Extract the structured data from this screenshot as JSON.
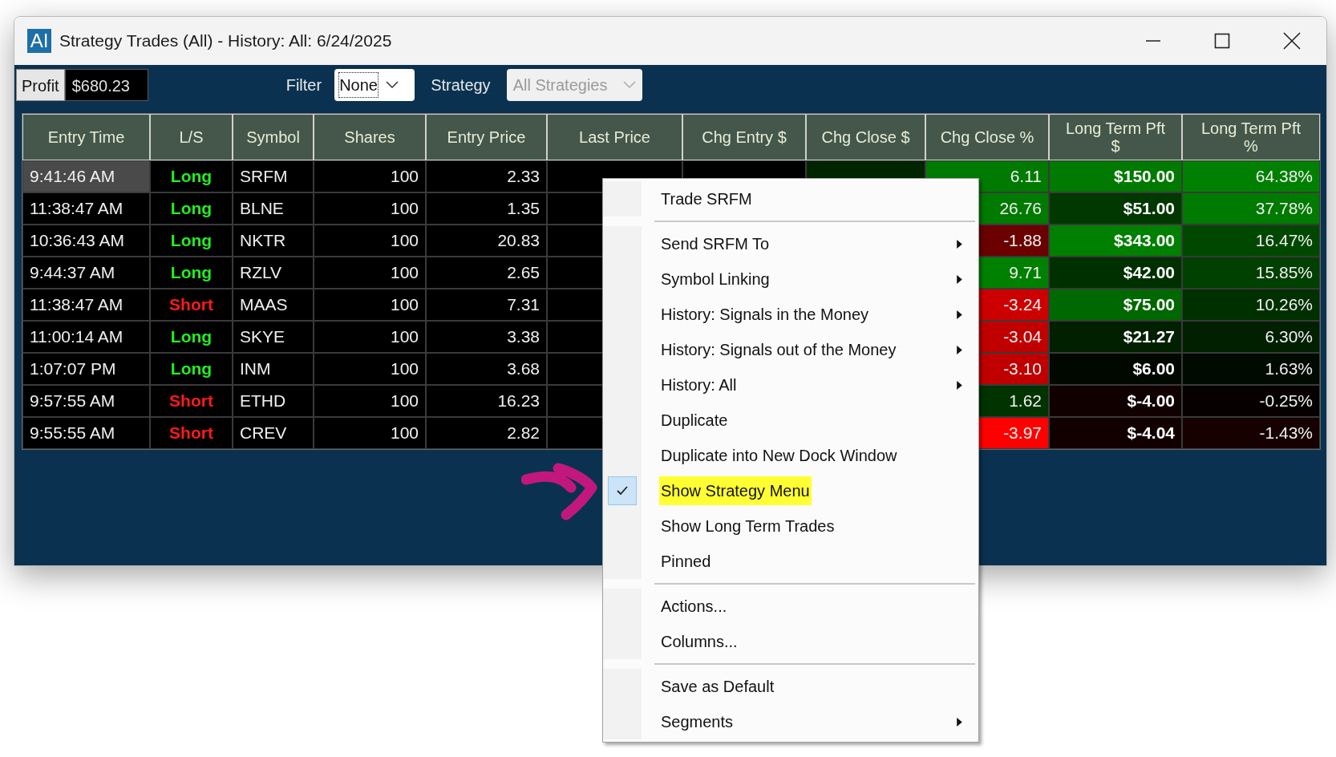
{
  "window": {
    "logo": "AI",
    "title": "Strategy Trades (All) - History: All: 6/24/2025"
  },
  "toolbar": {
    "profit_label": "Profit",
    "profit_value": "$680.23",
    "filter_label": "Filter",
    "filter_value": "None",
    "strategy_label": "Strategy",
    "strategy_value": "All Strategies",
    "strategy_disabled": true
  },
  "table": {
    "columns": [
      "Entry Time",
      "L/S",
      "Symbol",
      "Shares",
      "Entry Price",
      "Last Price",
      "Chg Entry $",
      "Chg Close $",
      "Chg Close %",
      "Long Term Pft\n$",
      "Long Term Pft\n%"
    ],
    "rows": [
      {
        "selected": true,
        "time": "9:41:46 AM",
        "side": {
          "kind": "long",
          "text": "Long"
        },
        "symbol": "SRFM",
        "shares": "100",
        "entry_price": "2.33",
        "chg_close": {
          "color": "#002400"
        },
        "chg_close_pct": {
          "text": "6.11",
          "color": "#007a00"
        },
        "lt_pft": {
          "text": "$150.00",
          "color": "#007a00"
        },
        "lt_pft_pct": {
          "text": "64.38%",
          "color": "#008000"
        }
      },
      {
        "selected": false,
        "time": "11:38:47 AM",
        "side": {
          "kind": "long",
          "text": "Long"
        },
        "symbol": "BLNE",
        "shares": "100",
        "entry_price": "1.35",
        "chg_close_pct": {
          "text": "26.76",
          "color": "#007a00"
        },
        "lt_pft": {
          "text": "$51.00",
          "color": "#003800"
        },
        "lt_pft_pct": {
          "text": "37.78%",
          "color": "#007a00"
        }
      },
      {
        "selected": false,
        "time": "10:36:43 AM",
        "side": {
          "kind": "long",
          "text": "Long"
        },
        "symbol": "NKTR",
        "shares": "100",
        "entry_price": "20.83",
        "chg_close_pct": {
          "text": "-1.88",
          "color": "#6a0000"
        },
        "lt_pft": {
          "text": "$343.00",
          "color": "#008000"
        },
        "lt_pft_pct": {
          "text": "16.47%",
          "color": "#004800"
        }
      },
      {
        "selected": false,
        "time": "9:44:37 AM",
        "side": {
          "kind": "long",
          "text": "Long"
        },
        "symbol": "RZLV",
        "shares": "100",
        "entry_price": "2.65",
        "chg_close_pct": {
          "text": "9.71",
          "color": "#008000"
        },
        "lt_pft": {
          "text": "$42.00",
          "color": "#003000"
        },
        "lt_pft_pct": {
          "text": "15.85%",
          "color": "#004000"
        }
      },
      {
        "selected": false,
        "time": "11:38:47 AM",
        "side": {
          "kind": "short",
          "text": "Short"
        },
        "symbol": "MAAS",
        "shares": "100",
        "entry_price": "7.31",
        "chg_close_pct": {
          "text": "-3.24",
          "color": "#cc0000"
        },
        "lt_pft": {
          "text": "$75.00",
          "color": "#006800"
        },
        "lt_pft_pct": {
          "text": "10.26%",
          "color": "#003000"
        }
      },
      {
        "selected": false,
        "time": "11:00:14 AM",
        "side": {
          "kind": "long",
          "text": "Long"
        },
        "symbol": "SKYE",
        "shares": "100",
        "entry_price": "3.38",
        "chg_close_pct": {
          "text": "-3.04",
          "color": "#c00000"
        },
        "lt_pft": {
          "text": "$21.27",
          "color": "#002000"
        },
        "lt_pft_pct": {
          "text": "6.30%",
          "color": "#002000"
        }
      },
      {
        "selected": false,
        "time": "1:07:07 PM",
        "side": {
          "kind": "long",
          "text": "Long"
        },
        "symbol": "INM",
        "shares": "100",
        "entry_price": "3.68",
        "chg_close_pct": {
          "text": "-3.10",
          "color": "#c00000"
        },
        "lt_pft": {
          "text": "$6.00",
          "color": "#000800"
        },
        "lt_pft_pct": {
          "text": "1.63%",
          "color": "#000a00"
        }
      },
      {
        "selected": false,
        "time": "9:57:55 AM",
        "side": {
          "kind": "short",
          "text": "Short"
        },
        "symbol": "ETHD",
        "shares": "100",
        "entry_price": "16.23",
        "chg_close_pct": {
          "text": "1.62",
          "color": "#003300"
        },
        "lt_pft": {
          "text": "$-4.00",
          "color": "#100000"
        },
        "lt_pft_pct": {
          "text": "-0.25%",
          "color": "#060000"
        }
      },
      {
        "selected": false,
        "time": "9:55:55 AM",
        "side": {
          "kind": "short",
          "text": "Short"
        },
        "symbol": "CREV",
        "shares": "100",
        "entry_price": "2.82",
        "chg_close_pct": {
          "text": "-3.97",
          "color": "#ff0000"
        },
        "lt_pft": {
          "text": "$-4.04",
          "color": "#120000"
        },
        "lt_pft_pct": {
          "text": "-1.43%",
          "color": "#160000"
        }
      }
    ]
  },
  "context_menu": {
    "items": [
      {
        "kind": "item",
        "label": "Trade SRFM",
        "submenu": false,
        "checked": false,
        "highlighted": false
      },
      {
        "kind": "separator"
      },
      {
        "kind": "item",
        "label": "Send SRFM To",
        "submenu": true,
        "checked": false,
        "highlighted": false
      },
      {
        "kind": "item",
        "label": "Symbol Linking",
        "submenu": true,
        "checked": false,
        "highlighted": false
      },
      {
        "kind": "item",
        "label": "History: Signals in the Money",
        "submenu": true,
        "checked": false,
        "highlighted": false
      },
      {
        "kind": "item",
        "label": "History: Signals out of the Money",
        "submenu": true,
        "checked": false,
        "highlighted": false
      },
      {
        "kind": "item",
        "label": "History: All",
        "submenu": true,
        "checked": false,
        "highlighted": false
      },
      {
        "kind": "item",
        "label": "Duplicate",
        "submenu": false,
        "checked": false,
        "highlighted": false
      },
      {
        "kind": "item",
        "label": "Duplicate into New Dock Window",
        "submenu": false,
        "checked": false,
        "highlighted": false
      },
      {
        "kind": "item",
        "label": "Show Strategy Menu",
        "submenu": false,
        "checked": true,
        "highlighted": true
      },
      {
        "kind": "item",
        "label": "Show Long Term Trades",
        "submenu": false,
        "checked": false,
        "highlighted": false
      },
      {
        "kind": "item",
        "label": "Pinned",
        "submenu": false,
        "checked": false,
        "highlighted": false
      },
      {
        "kind": "separator"
      },
      {
        "kind": "item",
        "label": "Actions...",
        "submenu": false,
        "checked": false,
        "highlighted": false
      },
      {
        "kind": "item",
        "label": "Columns...",
        "submenu": false,
        "checked": false,
        "highlighted": false
      },
      {
        "kind": "separator"
      },
      {
        "kind": "item",
        "label": "Save as Default",
        "submenu": false,
        "checked": false,
        "highlighted": false
      },
      {
        "kind": "item",
        "label": "Segments",
        "submenu": true,
        "checked": false,
        "highlighted": false
      }
    ]
  }
}
